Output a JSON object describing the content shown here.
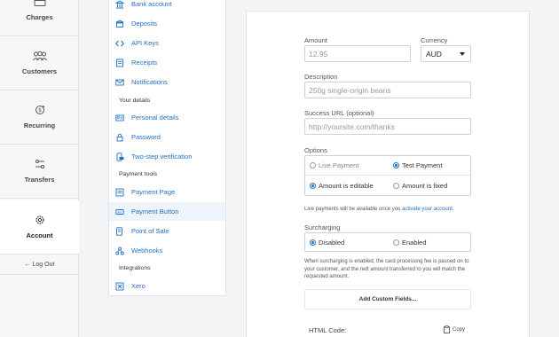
{
  "nav": {
    "items": [
      {
        "label": "Charges",
        "icon": "card-icon"
      },
      {
        "label": "Customers",
        "icon": "people-icon"
      },
      {
        "label": "Recurring",
        "icon": "recurring-icon"
      },
      {
        "label": "Transfers",
        "icon": "transfers-icon"
      },
      {
        "label": "Account",
        "icon": "gear-icon"
      }
    ],
    "logout": "← Log Out"
  },
  "settings_menu": {
    "items": [
      {
        "label": "Bank account",
        "icon": "bank-icon"
      },
      {
        "label": "Deposits",
        "icon": "deposits-icon"
      },
      {
        "label": "API Keys",
        "icon": "code-icon"
      },
      {
        "label": "Receipts",
        "icon": "receipt-icon"
      },
      {
        "label": "Notifications",
        "icon": "mail-icon"
      },
      {
        "label": "Personal details",
        "icon": "id-card-icon"
      },
      {
        "label": "Password",
        "icon": "lock-icon"
      },
      {
        "label": "Two-step verification",
        "icon": "phone-icon"
      },
      {
        "label": "Payment Page",
        "icon": "page-icon"
      },
      {
        "label": "Payment Button",
        "icon": "button-icon"
      },
      {
        "label": "Point of Sale",
        "icon": "pos-icon"
      },
      {
        "label": "Webhooks",
        "icon": "webhook-icon"
      },
      {
        "label": "Xero",
        "icon": "xero-icon"
      }
    ],
    "headings": {
      "your_details": "Your details",
      "payment_tools": "Payment tools",
      "integrations": "Integrations"
    },
    "active": "Payment Button"
  },
  "form": {
    "amount_label": "Amount",
    "amount_placeholder": "12.95",
    "currency_label": "Currency",
    "currency_value": "AUD",
    "description_label": "Description",
    "description_placeholder": "250g single-origin beans",
    "success_url_label": "Success URL (optional)",
    "success_url_placeholder": "http://yoursite.com/thanks",
    "options_label": "Options",
    "live_payment": "Live Payment",
    "test_payment": "Test Payment",
    "amount_editable": "Amount is editable",
    "amount_fixed": "Amount is fixed",
    "live_note_prefix": "Live payments will be available once you",
    "live_note_link": "activate your account",
    "live_note_suffix": ".",
    "surcharging_label": "Surcharging",
    "disabled": "Disabled",
    "enabled": "Enabled",
    "surcharge_note_1": "When surcharging is enabled, the card processing fee is passed on to",
    "surcharge_note_2": "your customer, and the nett amount transferred to you will match the",
    "surcharge_note_3": "requested amount.",
    "add_custom_fields": "Add Custom Fields...",
    "html_code_label": "HTML Code:",
    "copy_label": "Copy"
  },
  "colors": {
    "accent": "#1f6fc5"
  }
}
